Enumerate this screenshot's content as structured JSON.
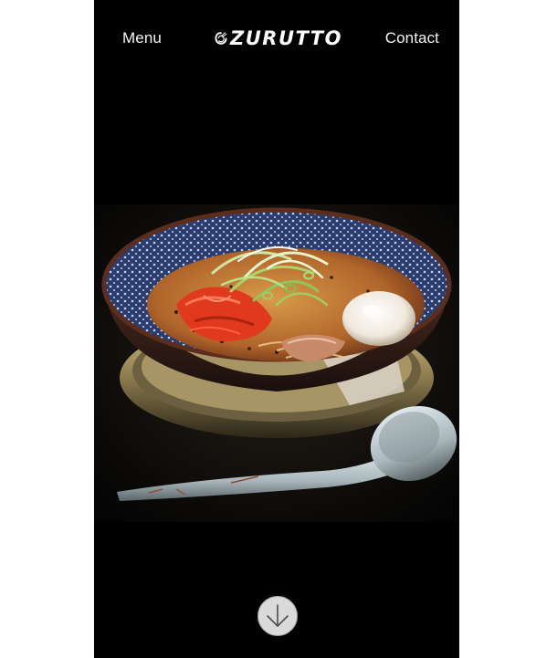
{
  "nav": {
    "menu_label": "Menu",
    "contact_label": "Contact"
  },
  "brand": {
    "logo_text": "ZURUTTO",
    "logo_alt": "Zurutto"
  },
  "hero": {
    "image_subject": "ramen-bowl-photo"
  },
  "scroll_button": {
    "icon": "arrow-down-icon"
  },
  "colors": {
    "page_background": "#ffffff",
    "frame_background": "#000000",
    "nav_text": "#f5f5f5",
    "scroll_button_fill": "#dadada",
    "scroll_button_border": "#a7a7a7"
  }
}
